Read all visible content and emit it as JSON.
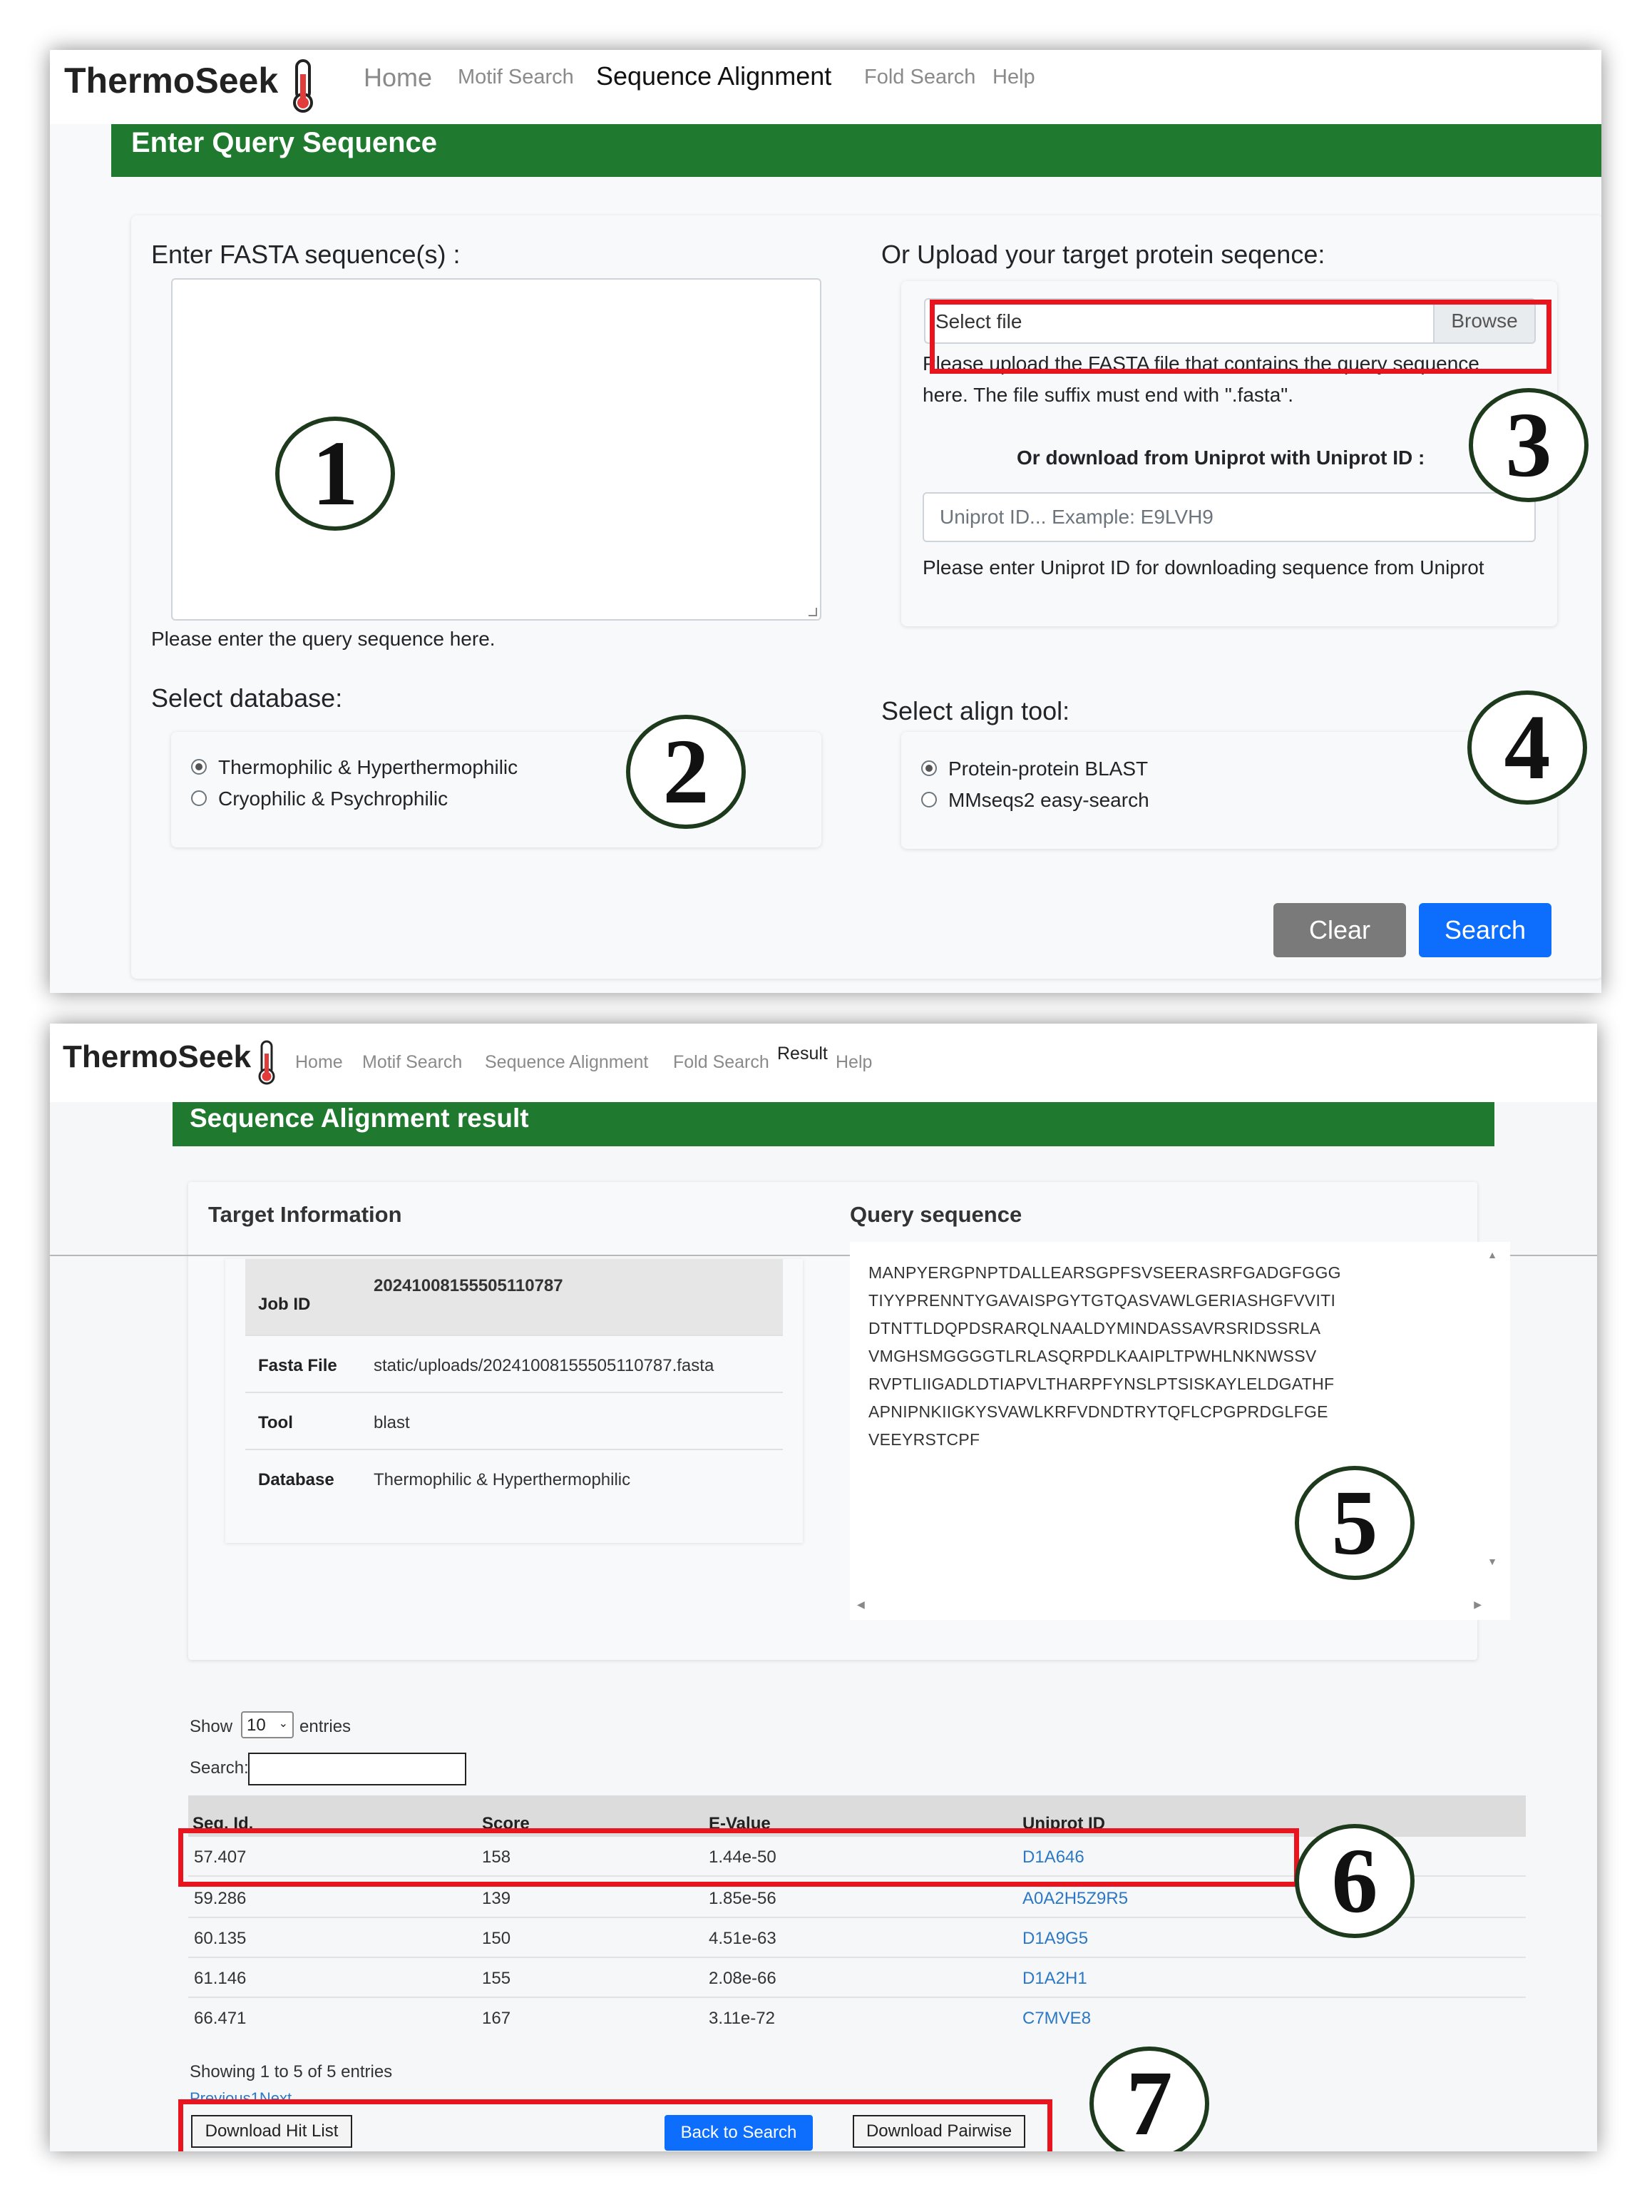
{
  "screen1": {
    "brand": "ThermoSeek",
    "nav": [
      "Home",
      "Motif Search",
      "Sequence Alignment",
      "Fold Search",
      "Help"
    ],
    "banner": "Enter Query Sequence",
    "fasta_label": "Enter FASTA sequence(s) :",
    "fasta_hint": "Please enter the query sequence here.",
    "upload_label": "Or Upload your target protein seqence:",
    "file_placeholder": "Select file",
    "browse_label": "Browse",
    "upload_hint_line1": "Please upload the FASTA file that contains the query sequence",
    "upload_hint_line2": "here. The file suffix must end with \".fasta\".",
    "uniprot_label": "Or download from Uniprot with Uniprot ID :",
    "uniprot_placeholder": "Uniprot ID... Example: E9LVH9",
    "uniprot_hint": "Please enter Uniprot ID for downloading sequence from Uniprot",
    "db_label": "Select database:",
    "db_options": [
      "Thermophilic & Hyperthermophilic",
      "Cryophilic & Psychrophilic"
    ],
    "db_selected": 0,
    "tool_label": "Select align tool:",
    "tool_options": [
      "Protein-protein BLAST",
      "MMseqs2 easy-search"
    ],
    "tool_selected": 0,
    "clear_label": "Clear",
    "search_label": "Search"
  },
  "screen2": {
    "brand": "ThermoSeek",
    "nav": [
      "Home",
      "Motif Search",
      "Sequence Alignment",
      "Fold Search",
      "Result",
      "Help"
    ],
    "banner": "Sequence Alignment result",
    "target_title": "Target Information",
    "query_title": "Query sequence",
    "info": [
      {
        "key": "Job ID",
        "value": "20241008155505110787"
      },
      {
        "key": "Fasta File",
        "value": "static/uploads/20241008155505110787.fasta"
      },
      {
        "key": "Tool",
        "value": "blast"
      },
      {
        "key": "Database",
        "value": "Thermophilic & Hyperthermophilic"
      }
    ],
    "sequence_lines": [
      "MANPYERGPNPTDALLEARSGPFSVSEERASRFGADGFGGG",
      "TIYYPRENNTYGAVAISPGYTGTQASVAWLGERIASHGFVVITI",
      "DTNTTLDQPDSRARQLNAALDYMINDASSAVRSRIDSSRLA",
      "VMGHSMGGGGTLRLASQRPDLKAAIPLTPWHLNKNWSSV",
      "RVPTLIIGADLDTIAPVLTHARPFYNSLPTSISKAYLELDGATHF",
      "APNIPNKIIGKYSVAWLKRFVDNDTRYTQFLCPGPRDGLFGE",
      "VEEYRSTCPF"
    ],
    "show_label": "Show",
    "show_value": "10",
    "entries_label": "entries",
    "search_label": "Search:",
    "columns": [
      "Seq. Id.",
      "Score",
      "E-Value",
      "Uniprot ID"
    ],
    "rows": [
      [
        "57.407",
        "158",
        "1.44e-50",
        "D1A646"
      ],
      [
        "59.286",
        "139",
        "1.85e-56",
        "A0A2H5Z9R5"
      ],
      [
        "60.135",
        "150",
        "4.51e-63",
        "D1A9G5"
      ],
      [
        "61.146",
        "155",
        "2.08e-66",
        "D1A2H1"
      ],
      [
        "66.471",
        "167",
        "3.11e-72",
        "C7MVE8"
      ]
    ],
    "showing_text": "Showing 1 to 5 of 5 entries",
    "pager_text": "Previous1Next",
    "download_hit_label": "Download Hit List",
    "back_label": "Back to Search",
    "download_pairwise_label": "Download Pairwise"
  },
  "annotations": [
    "1",
    "2",
    "3",
    "4",
    "5",
    "6",
    "7"
  ],
  "colors": {
    "banner_green": "#1f7a30",
    "primary_blue": "#0d6efd",
    "clear_gray": "#7a7a7a",
    "highlight_red": "#e8141e",
    "link_blue": "#2c78c4"
  }
}
